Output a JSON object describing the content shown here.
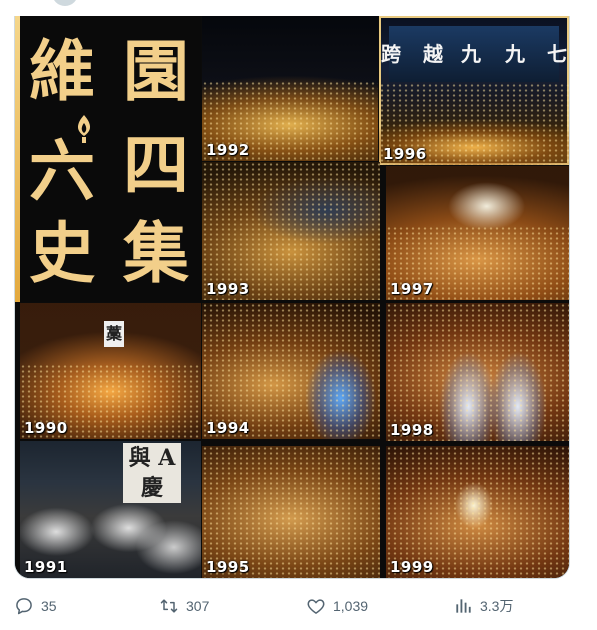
{
  "media": {
    "title_chars": [
      "維",
      "園",
      "六",
      "四",
      "史",
      "集"
    ],
    "tiles": [
      {
        "year": "1992"
      },
      {
        "year": "1996",
        "banner_chars": [
          "跨",
          "越",
          "九",
          "九",
          "七"
        ]
      },
      {
        "year": "1993"
      },
      {
        "year": "1997"
      },
      {
        "year": "1990",
        "banner_char": "藁"
      },
      {
        "year": "1994"
      },
      {
        "year": "1998"
      },
      {
        "year": "1991",
        "banner_text": "與 A 慶"
      },
      {
        "year": "1995"
      },
      {
        "year": "1999"
      }
    ]
  },
  "actions": {
    "reply": {
      "icon": "reply-icon",
      "count": "35"
    },
    "retweet": {
      "icon": "retweet-icon",
      "count": "307"
    },
    "like": {
      "icon": "heart-icon",
      "count": "1,039"
    },
    "views": {
      "icon": "views-icon",
      "count": "3.3万"
    }
  },
  "colors": {
    "title_gold": "#f2cf8a",
    "action_gray": "#536471",
    "card_border": "#cfd9de"
  }
}
